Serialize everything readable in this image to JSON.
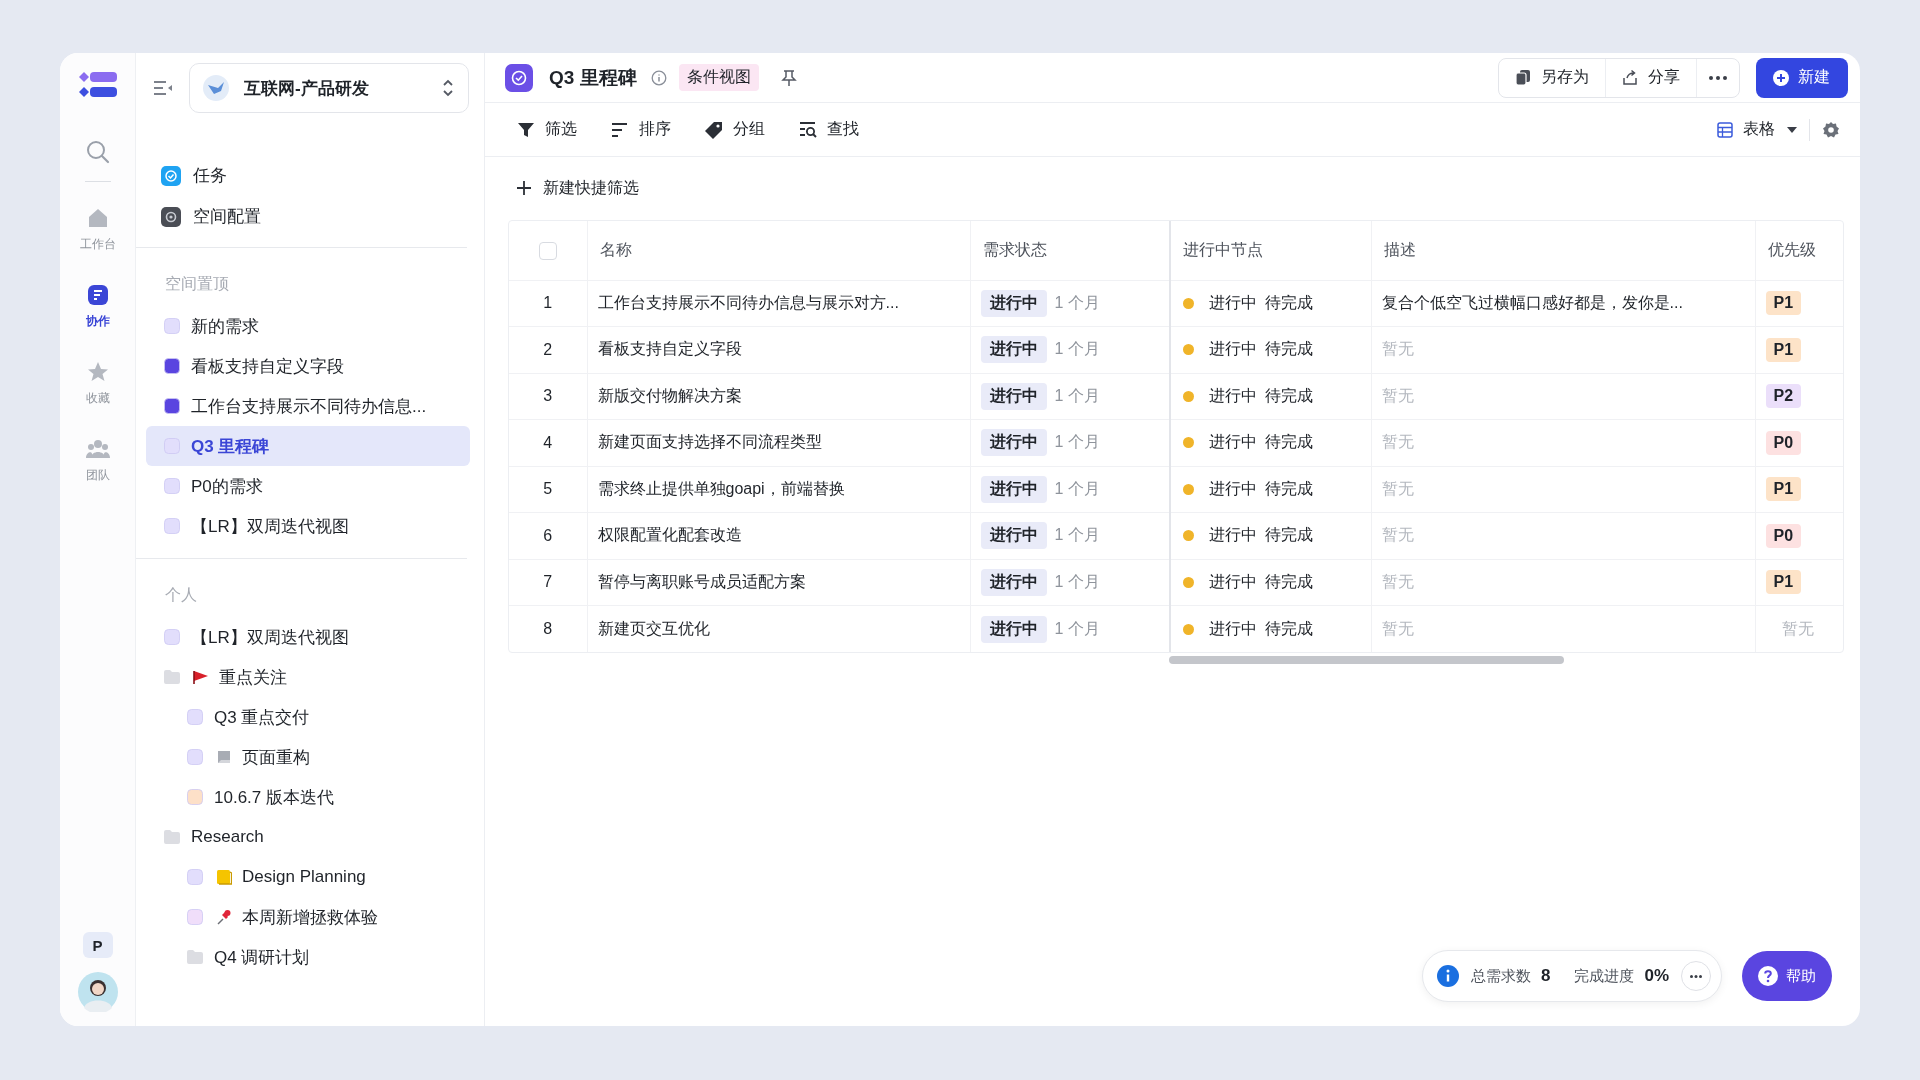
{
  "rail": {
    "items": [
      {
        "label": "工作台",
        "kind": "home",
        "selected": false
      },
      {
        "label": "协作",
        "kind": "collab",
        "selected": true
      },
      {
        "label": "收藏",
        "kind": "star",
        "selected": false
      },
      {
        "label": "团队",
        "kind": "team",
        "selected": false
      }
    ],
    "workspace_initial": "P"
  },
  "workspace": {
    "name": "互联网-产品研发"
  },
  "apps": [
    {
      "label": "任务",
      "kind": "task",
      "color": "#1fa3f2"
    },
    {
      "label": "空间配置",
      "kind": "config",
      "color": "#4a4d55"
    }
  ],
  "sections": [
    {
      "title": "空间置顶",
      "items": [
        {
          "label": "新的需求",
          "kind": "view",
          "color": "#e2defc",
          "selected": false
        },
        {
          "label": "看板支持自定义字段",
          "kind": "view",
          "color": "#5a45e0",
          "selected": false
        },
        {
          "label": "工作台支持展示不同待办信息...",
          "kind": "view",
          "color": "#5a45e0",
          "selected": false
        },
        {
          "label": "Q3 里程碑",
          "kind": "view",
          "color": "#e2defc",
          "selected": true
        },
        {
          "label": "P0的需求",
          "kind": "view",
          "color": "#e2defc",
          "selected": false
        },
        {
          "label": "【LR】双周迭代视图",
          "kind": "view",
          "color": "#e2defc",
          "selected": false
        }
      ]
    },
    {
      "title": "个人",
      "items": [
        {
          "label": "【LR】双周迭代视图",
          "kind": "view",
          "color": "#e2defc",
          "selected": false
        },
        {
          "label": "重点关注",
          "kind": "flagged",
          "color": "#dcdde2",
          "selected": false,
          "children": [
            {
              "label": "Q3 重点交付",
              "kind": "view",
              "color": "#e2defc",
              "selected": false
            },
            {
              "label": "页面重构",
              "kind": "paged",
              "color": "#e2defc",
              "selected": false
            },
            {
              "label": "10.6.7 版本迭代",
              "kind": "view",
              "color": "#fde0c8",
              "selected": false
            }
          ]
        },
        {
          "label": "Research",
          "kind": "folder",
          "color": "#dcdde2",
          "selected": false,
          "children": [
            {
              "label": "Design Planning",
              "kind": "noted",
              "color": "#e2defc",
              "selected": false
            },
            {
              "label": "本周新增拯救体验",
              "kind": "pinned",
              "color": "#f0defa",
              "selected": false
            },
            {
              "label": "Q4 调研计划",
              "kind": "folder",
              "color": "#dcdde2",
              "selected": false
            }
          ]
        }
      ]
    }
  ],
  "header": {
    "title": "Q3 里程碑",
    "view_tag": "条件视图",
    "actions": [
      {
        "label": "另存为",
        "kind": "saveas"
      },
      {
        "label": "分享",
        "kind": "share"
      }
    ],
    "new_button": "新建"
  },
  "toolbar": {
    "tools": [
      {
        "label": "筛选",
        "kind": "filter"
      },
      {
        "label": "排序",
        "kind": "sort"
      },
      {
        "label": "分组",
        "kind": "group"
      },
      {
        "label": "查找",
        "kind": "find"
      }
    ],
    "view_switch": "表格"
  },
  "quick_filter": "新建快捷筛选",
  "table": {
    "select_all_checked": false,
    "columns": [
      "名称",
      "需求状态",
      "进行中节点",
      "描述",
      "优先级"
    ],
    "rows": [
      {
        "index": "1",
        "name": "工作台支持展示不同待办信息与展示对方...",
        "status": "进行中",
        "duration": "1 个月",
        "node": {
          "color": "#f0b429",
          "state": "进行中",
          "step": "待完成"
        },
        "description": {
          "text": "复合个低空飞过横幅口感好都是，发你是...",
          "empty": false
        },
        "priority": {
          "text": "P1",
          "color": "#fde3c8"
        }
      },
      {
        "index": "2",
        "name": "看板支持自定义字段",
        "status": "进行中",
        "duration": "1 个月",
        "node": {
          "color": "#f0b429",
          "state": "进行中",
          "step": "待完成"
        },
        "description": {
          "text": "暂无",
          "empty": true
        },
        "priority": {
          "text": "P1",
          "color": "#fde3c8"
        }
      },
      {
        "index": "3",
        "name": "新版交付物解决方案",
        "status": "进行中",
        "duration": "1 个月",
        "node": {
          "color": "#f0b429",
          "state": "进行中",
          "step": "待完成"
        },
        "description": {
          "text": "暂无",
          "empty": true
        },
        "priority": {
          "text": "P2",
          "color": "#ebdffa"
        }
      },
      {
        "index": "4",
        "name": "新建页面支持选择不同流程类型",
        "status": "进行中",
        "duration": "1 个月",
        "node": {
          "color": "#f0b429",
          "state": "进行中",
          "step": "待完成"
        },
        "description": {
          "text": "暂无",
          "empty": true
        },
        "priority": {
          "text": "P0",
          "color": "#fde1e1"
        }
      },
      {
        "index": "5",
        "name": "需求终止提供单独goapi，前端替换",
        "status": "进行中",
        "duration": "1 个月",
        "node": {
          "color": "#f0b429",
          "state": "进行中",
          "step": "待完成"
        },
        "description": {
          "text": "暂无",
          "empty": true
        },
        "priority": {
          "text": "P1",
          "color": "#fde3c8"
        }
      },
      {
        "index": "6",
        "name": "权限配置化配套改造",
        "status": "进行中",
        "duration": "1 个月",
        "node": {
          "color": "#f0b429",
          "state": "进行中",
          "step": "待完成"
        },
        "description": {
          "text": "暂无",
          "empty": true
        },
        "priority": {
          "text": "P0",
          "color": "#fde1e1"
        }
      },
      {
        "index": "7",
        "name": "暂停与离职账号成员适配方案",
        "status": "进行中",
        "duration": "1 个月",
        "node": {
          "color": "#f0b429",
          "state": "进行中",
          "step": "待完成"
        },
        "description": {
          "text": "暂无",
          "empty": true
        },
        "priority": {
          "text": "P1",
          "color": "#fde3c8"
        }
      },
      {
        "index": "8",
        "name": "新建页交互优化",
        "status": "进行中",
        "duration": "1 个月",
        "node": {
          "color": "#f0b429",
          "state": "进行中",
          "step": "待完成"
        },
        "description": {
          "text": "暂无",
          "empty": true
        },
        "priority": {
          "text": "暂无"
        }
      }
    ]
  },
  "summary": {
    "total_label": "总需求数",
    "total": "8",
    "progress_label": "完成进度",
    "progress": "0%"
  },
  "help": "帮助"
}
